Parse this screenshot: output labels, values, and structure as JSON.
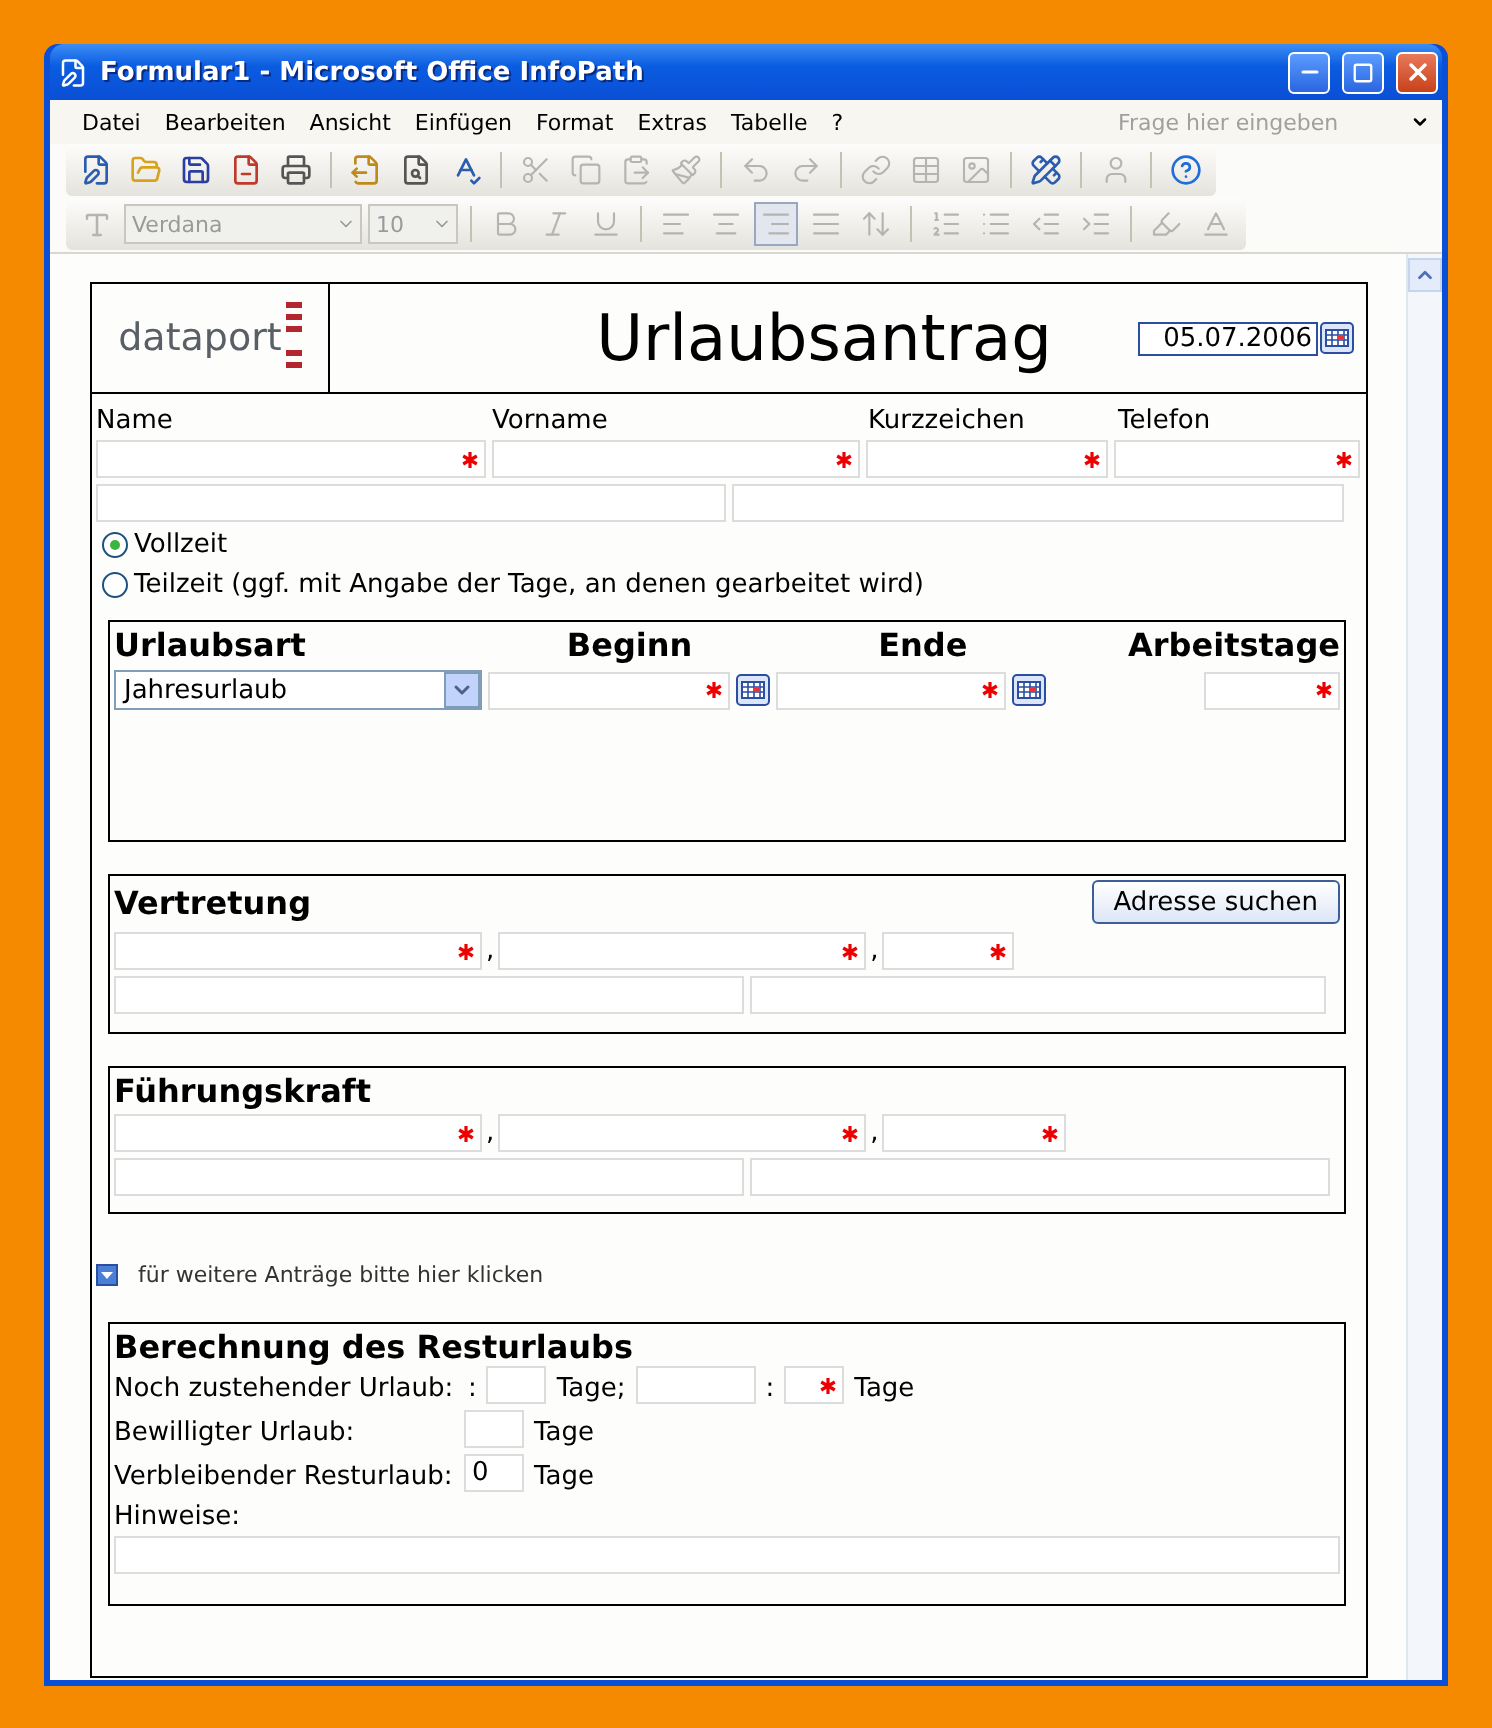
{
  "window": {
    "title": "Formular1 - Microsoft Office InfoPath"
  },
  "menu": [
    "Datei",
    "Bearbeiten",
    "Ansicht",
    "Einfügen",
    "Format",
    "Extras",
    "Tabelle",
    "?"
  ],
  "help_box": {
    "placeholder": "Frage hier eingeben"
  },
  "standard_toolbar": [
    [
      {
        "kind": "edit",
        "disabled": false
      },
      {
        "kind": "open",
        "disabled": false
      },
      {
        "kind": "save",
        "disabled": false
      },
      {
        "kind": "permission",
        "disabled": false
      },
      {
        "kind": "print",
        "disabled": false
      }
    ],
    [
      {
        "kind": "export",
        "disabled": false
      },
      {
        "kind": "preview",
        "disabled": false
      },
      {
        "kind": "spelling",
        "disabled": false
      }
    ],
    [
      {
        "kind": "cut",
        "disabled": true
      },
      {
        "kind": "copy",
        "disabled": true
      },
      {
        "kind": "paste",
        "disabled": true
      },
      {
        "kind": "painter",
        "disabled": true
      }
    ],
    [
      {
        "kind": "undo",
        "disabled": true
      },
      {
        "kind": "redo",
        "disabled": true
      }
    ],
    [
      {
        "kind": "link",
        "disabled": true
      },
      {
        "kind": "table",
        "disabled": true
      },
      {
        "kind": "picture",
        "disabled": true
      }
    ],
    [
      {
        "kind": "design",
        "disabled": false
      }
    ],
    [
      {
        "kind": "user",
        "disabled": true
      }
    ],
    [
      {
        "kind": "help",
        "disabled": false
      }
    ]
  ],
  "format_toolbar": {
    "font": "Verdana",
    "size": "10",
    "groups": [
      [
        {
          "kind": "bold",
          "disabled": true,
          "selected": false
        },
        {
          "kind": "italic",
          "disabled": true,
          "selected": false
        },
        {
          "kind": "underline",
          "disabled": true,
          "selected": false
        }
      ],
      [
        {
          "kind": "align-left",
          "disabled": true,
          "selected": false
        },
        {
          "kind": "align-center",
          "disabled": true,
          "selected": false
        },
        {
          "kind": "align-right",
          "disabled": true,
          "selected": true
        },
        {
          "kind": "justify",
          "disabled": true,
          "selected": false
        },
        {
          "kind": "spacing",
          "disabled": true,
          "selected": false
        }
      ],
      [
        {
          "kind": "numbering",
          "disabled": true,
          "selected": false
        },
        {
          "kind": "bullets",
          "disabled": true,
          "selected": false
        },
        {
          "kind": "outdent",
          "disabled": true,
          "selected": false
        },
        {
          "kind": "indent",
          "disabled": true,
          "selected": false
        }
      ],
      [
        {
          "kind": "highlight",
          "disabled": true,
          "selected": false
        },
        {
          "kind": "font-color",
          "disabled": true,
          "selected": false
        }
      ]
    ]
  },
  "form": {
    "logo": "dataport",
    "title": "Urlaubsantrag",
    "date": "05.07.2006",
    "person_fields": [
      {
        "label": "Name",
        "required": true
      },
      {
        "label": "Vorname",
        "required": true
      },
      {
        "label": "Kurzzeichen",
        "required": true
      },
      {
        "label": "Telefon",
        "required": true
      }
    ],
    "work_time": [
      {
        "label": "Vollzeit",
        "selected": true
      },
      {
        "label": "Teilzeit (ggf. mit Angabe der Tage, an denen gearbeitet wird)",
        "selected": false
      }
    ],
    "leave": {
      "columns": [
        "Urlaubsart",
        "Beginn",
        "Ende",
        "Arbeitstage"
      ],
      "type": "Jahresurlaub"
    },
    "contacts": [
      {
        "title": "Vertretung",
        "button": "Adresse suchen",
        "separators": [
          ",",
          ","
        ]
      },
      {
        "title": "Führungskraft",
        "separators": [
          ",",
          ","
        ]
      }
    ],
    "more_link": "für weitere Anträge bitte hier klicken",
    "calculation": {
      "title": "Berechnung des Resturlaubs",
      "rows": [
        {
          "label": "Noch zustehender Urlaub:",
          "parts": [
            {
              "kind": "text",
              "text": ":"
            },
            {
              "kind": "field",
              "required": false
            },
            {
              "kind": "text",
              "text": "Tage;"
            },
            {
              "kind": "wide_field",
              "required": false
            },
            {
              "kind": "text",
              "text": ":"
            },
            {
              "kind": "field",
              "required": true
            },
            {
              "kind": "text",
              "text": "Tage"
            }
          ]
        },
        {
          "label": "Bewilligter Urlaub:",
          "parts": [
            {
              "kind": "field",
              "required": false
            },
            {
              "kind": "text",
              "text": "Tage"
            }
          ]
        },
        {
          "label": "Verbleibender Resturlaub:",
          "parts": [
            {
              "kind": "field",
              "value": "0",
              "required": false
            },
            {
              "kind": "text",
              "text": "Tage"
            }
          ]
        }
      ],
      "notes_label": "Hinweise:"
    }
  }
}
